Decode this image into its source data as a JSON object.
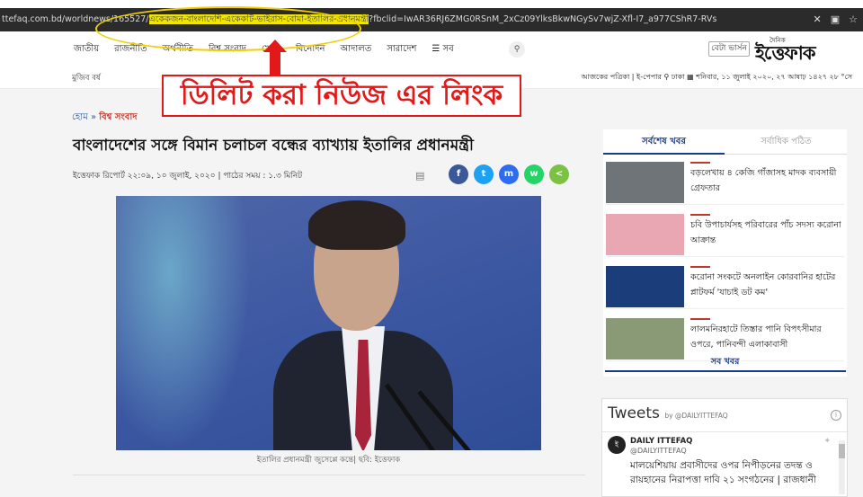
{
  "browser": {
    "url_prefix": "ttefaq.com.bd/worldnews/165527/",
    "url_highlight": "একেকজন-বাংলাদেশি-একেকটি-ভাইরাস-বোমা-ইতালির-প্রধানমন্ত্রী",
    "url_suffix": "?fbclid=IwAR36RJ6ZMG0RSnM_2xCz09YlksBkwNGySv7wjZ-Xfl-I7_a977CShR7-RVs",
    "icons": [
      "bookmark-slash-icon",
      "tab-icon",
      "star-icon"
    ]
  },
  "nav": {
    "menu": [
      "জাতীয়",
      "রাজনীতি",
      "অর্থনীতি",
      "বিশ্ব সংবাদ",
      "খেলা",
      "বিনোদন",
      "আদালত",
      "সারাদেশ",
      "☰ সব"
    ],
    "beta_button": "বেটা ভার্সন",
    "logo_small": "দৈনিক",
    "logo": "ইত্তেফাক",
    "sub_left": "মুজিব বর্ষ",
    "right_info": "আজকের পত্রিকা | ই-পেপার   ⚲ ঢাকা  ▦ শনিবার, ১১ জুলাই ২০২০, ২৭ আষাঢ় ১৪২৭  ২৮ °সে"
  },
  "annotation": {
    "callout_text": "ডিলিট করা নিউজ এর লিংক",
    "arrow_color": "#e31919",
    "circle_color": "#f0d000"
  },
  "article": {
    "breadcrumb_home": "হোম",
    "breadcrumb_sep": "»",
    "breadcrumb_section": "বিশ্ব সংবাদ",
    "headline": "বাংলাদেশের সঙ্গে বিমান চলাচল বন্ধের ব্যাখ্যায় ইতালির প্রধানমন্ত্রী",
    "meta": "ইত্তেফাক রিপোর্ট  ২২:০৯, ১০ জুলাই, ২০২০ |  পাঠের সময় : ১.৩ মিনিট",
    "caption": "ইতালির প্রধানমন্ত্রী জুসেপ্পে কন্তে| ছবি: ইত্তেফাক",
    "share": [
      {
        "name": "facebook",
        "glyph": "f",
        "color": "#3b5998"
      },
      {
        "name": "twitter",
        "glyph": "t",
        "color": "#1da1f2"
      },
      {
        "name": "messenger",
        "glyph": "m",
        "color": "#2d6cf0"
      },
      {
        "name": "whatsapp",
        "glyph": "w",
        "color": "#25d366"
      },
      {
        "name": "share",
        "glyph": "<",
        "color": "#7cc242"
      }
    ]
  },
  "sidebar": {
    "tab_latest": "সর্বশেষ খবর",
    "tab_most_read": "সর্বাধিক পঠিত",
    "news": [
      {
        "title": "বড়লেখায় ৪ কেজি গাঁজাসহ মাদক ব্যবসায়ী গ্রেফতার",
        "thumb_color": "#6f7478"
      },
      {
        "title": "চবি উপাচার্যসহ পরিবারের পাঁচ সদস্য করোনা আক্রান্ত",
        "thumb_color": "#e8a7b3"
      },
      {
        "title": "করোনা সংকটে অনলাইন কোরবানির হাটের প্লাটফর্ম 'যাচাই ডট কম'",
        "thumb_color": "#1b3d7a"
      },
      {
        "title": "লালমনিরহাটে তিস্তার পানি বিপৎসীমার ওপরে, পানিবন্দী এলাকাবাসী",
        "thumb_color": "#8a9a76"
      }
    ],
    "more": "সব খবর"
  },
  "tweets": {
    "title": "Tweets",
    "by": "by @DAILYITTEFAQ",
    "name": "DAILY ITTEFAQ",
    "handle": "@DAILYITTEFAQ",
    "text": "মালয়েশিয়ায় প্রবাসীদের ওপর নিপীড়নের তদন্ত ও রায়হানের নিরাপত্তা দাবি ২১ সংগঠনের | রাজধানী"
  }
}
